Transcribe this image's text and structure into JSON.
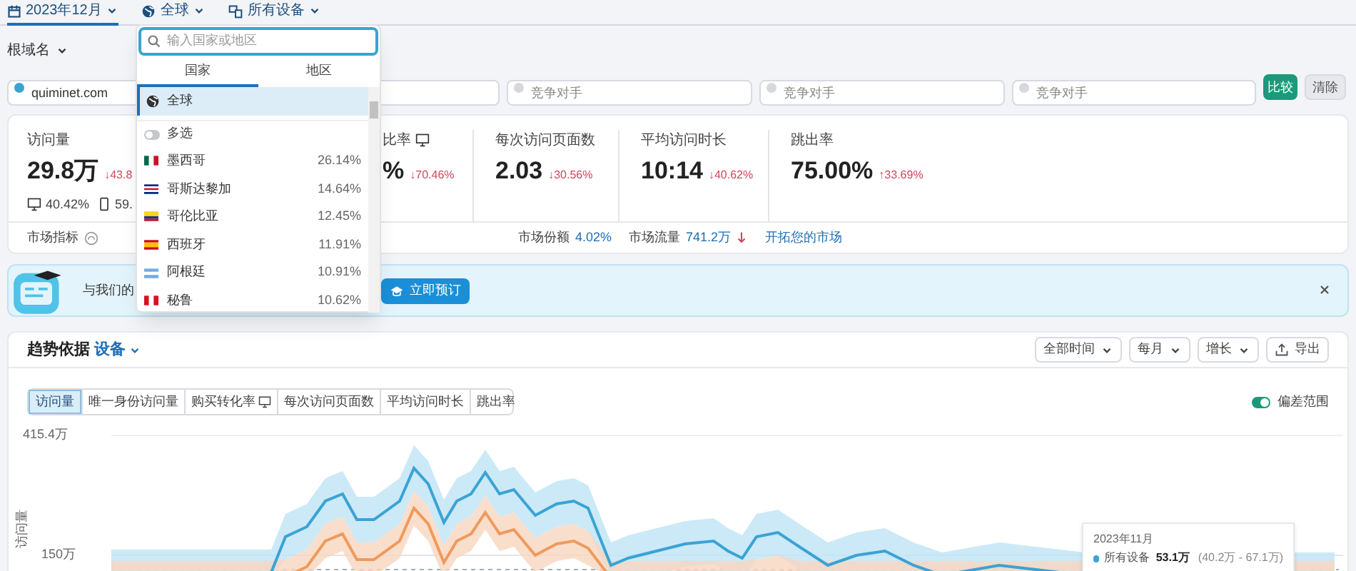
{
  "top_filters": [
    {
      "kind": "date",
      "label": "2023年12月",
      "selected": true
    },
    {
      "kind": "globe",
      "label": "全球",
      "selected": false
    },
    {
      "kind": "device",
      "label": "所有设备",
      "selected": false
    }
  ],
  "domain_label": "根域名",
  "sites": [
    {
      "kind": "main",
      "value": "quiminet.com"
    },
    {
      "kind": "competitor",
      "placeholder": "竞争对手"
    },
    {
      "kind": "competitor",
      "placeholder": "竞争对手"
    },
    {
      "kind": "competitor",
      "placeholder": "竞争对手"
    }
  ],
  "compare_button": "比较",
  "clear_button": "清除",
  "metrics": [
    {
      "label": "访问量",
      "value": "29.8万",
      "change": "↓43.8",
      "devices": [
        {
          "kind": "desktop",
          "value": "40.42%"
        },
        {
          "kind": "mobile",
          "value": "59."
        }
      ]
    },
    {
      "label": "比率",
      "value": "%",
      "change": "↓70.46%",
      "desktop_only": true
    },
    {
      "label": "每次访问页面数",
      "value": "2.03",
      "change": "↓30.56%"
    },
    {
      "label": "平均访问时长",
      "value": "10:14",
      "change": "↓40.62%"
    },
    {
      "label": "跳出率",
      "value": "75.00%",
      "change": "↑33.69%"
    }
  ],
  "market": {
    "label": "市场指标",
    "share_label": "市场份额",
    "share": "4.02%",
    "traffic_label": "市场流量",
    "traffic": "741.2万",
    "link": "开拓您的市场"
  },
  "banner": {
    "text": "与我们的",
    "button": "立即预订"
  },
  "trend": {
    "title": "趋势依据",
    "by": "设备",
    "controls": [
      {
        "kind": "select",
        "label": "全部时间"
      },
      {
        "kind": "select",
        "label": "每月"
      },
      {
        "kind": "select",
        "label": "增长"
      },
      {
        "kind": "export",
        "label": "导出"
      }
    ],
    "tabs": [
      {
        "label": "访问量",
        "selected": true
      },
      {
        "label": "唯一身份访问量",
        "selected": false
      },
      {
        "label": "购买转化率",
        "selected": false,
        "desktop_only": true
      },
      {
        "label": "每次访问页面数",
        "selected": false
      },
      {
        "label": "平均访问时长",
        "selected": false
      },
      {
        "label": "跳出率",
        "selected": false
      }
    ],
    "range_toggle": {
      "label": "偏差范围",
      "on": true
    },
    "chart": {
      "y_axis_label": "访问量",
      "y_ticks": [
        "415.4万",
        "150万"
      ]
    },
    "tooltip": {
      "title": "2023年11月",
      "series": "所有设备",
      "value": "53.1万",
      "range": "(40.2万 - 67.1万)",
      "color": "#3aa3d4"
    }
  },
  "country_dropdown": {
    "search_placeholder": "输入国家或地区",
    "tabs": [
      {
        "label": "国家",
        "selected": true
      },
      {
        "label": "地区",
        "selected": false
      }
    ],
    "global": {
      "label": "全球",
      "selected": true
    },
    "multi_select": {
      "label": "多选",
      "on": false
    },
    "countries": [
      {
        "name": "墨西哥",
        "share": "26.14%"
      },
      {
        "name": "哥斯达黎加",
        "share": "14.64%"
      },
      {
        "name": "哥伦比亚",
        "share": "12.45%"
      },
      {
        "name": "西班牙",
        "share": "11.91%"
      },
      {
        "name": "阿根廷",
        "share": "10.91%"
      },
      {
        "name": "秘鲁",
        "share": "10.62%"
      }
    ]
  }
}
